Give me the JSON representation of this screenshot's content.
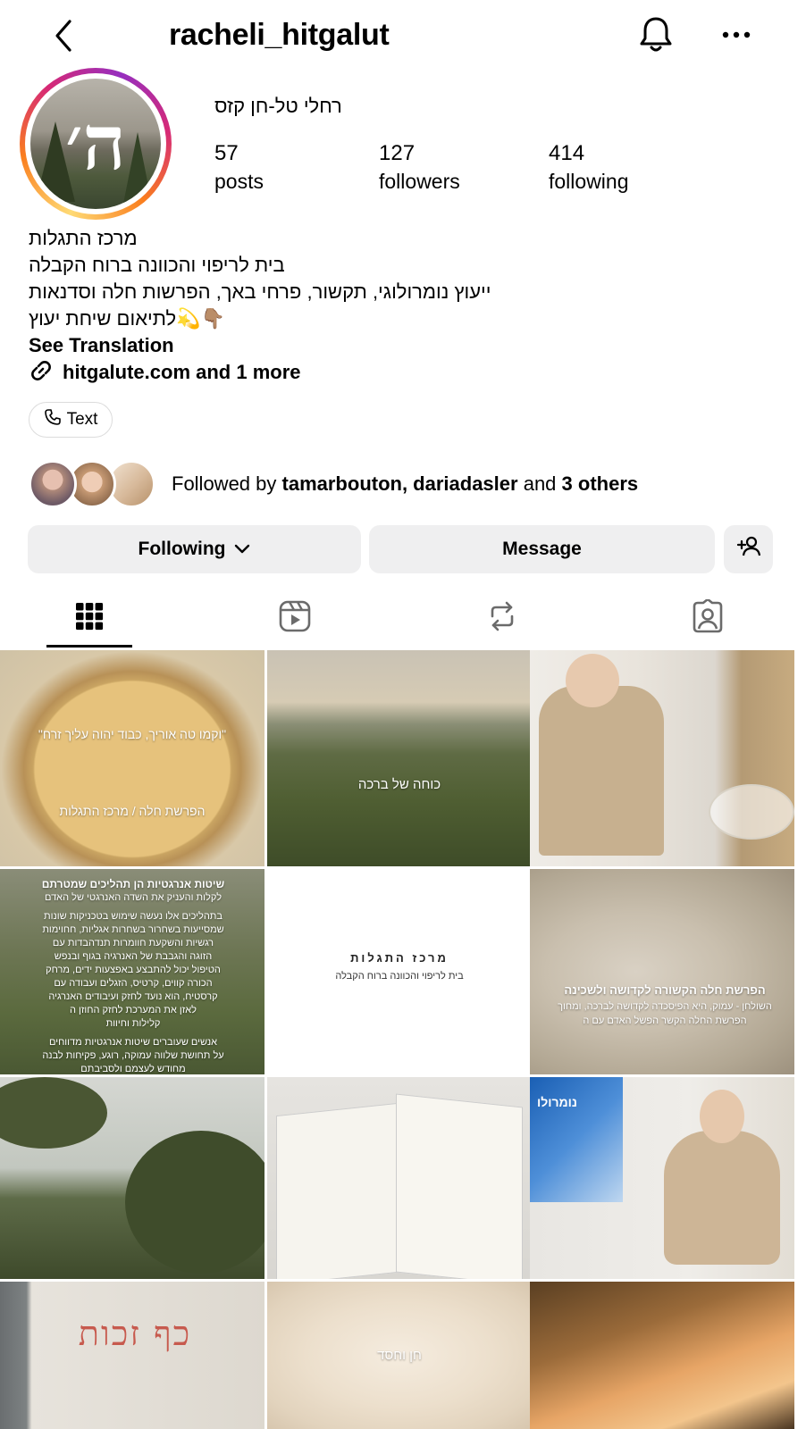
{
  "header": {
    "username": "racheli_hitgalut"
  },
  "profile": {
    "avatar_letter": "ה׳",
    "full_name": "רחלי טל-חן קזס",
    "stats": [
      {
        "value": "57",
        "label": "posts"
      },
      {
        "value": "127",
        "label": "followers"
      },
      {
        "value": "414",
        "label": "following"
      }
    ],
    "bio": {
      "line1": "מרכז התגלות",
      "line2": "בית לריפוי והכוונה ברוח הקבלה",
      "line3": "ייעוץ נומרולוגי, תקשור, פרחי באך, הפרשות חלה וסדנאות",
      "line4": "👇🏽💫לתיאום שיחת יעוץ"
    },
    "see_translation": "See Translation",
    "link_text": "hitgalute.com and 1 more",
    "contact_chip": "Text"
  },
  "followed_by": {
    "prefix": "Followed by ",
    "names": "tamarbouton, dariadasler",
    "middle": " and ",
    "others": "3 others"
  },
  "actions": {
    "following": "Following",
    "message": "Message"
  },
  "tabs": [
    {
      "icon": "grid-icon",
      "active": true
    },
    {
      "icon": "reels-icon",
      "active": false
    },
    {
      "icon": "reposts-icon",
      "active": false
    },
    {
      "icon": "tagged-icon",
      "active": false
    }
  ],
  "posts": {
    "p1_quote": "\"וקמו טה אוריך, כבוד יהוה עליך זרח\"",
    "p1_caption": "הפרשת חלה / מרכז התגלות",
    "p2_caption": "כוחה של ברכה",
    "p4_title": "שיטות אנרגטיות הן תהליכים שמטרתם",
    "p4_line1": "לקלות והעניק את השדה האנרגטי של האדם",
    "p4_line2": "בתהליכים אלו נעשה שימוש בטכניקות שונות",
    "p4_line3": "שמסייעות בשחרור בשחרות אגליות, חחוימות",
    "p4_line4": "רגשיות והשקעת חוומרות תנדהבדות עם",
    "p4_line5": "הזוגה והגבבת של האנרגיה בגוף ובנפש",
    "p4_line6": "הטיפול יכול להתבצע באפצעות ידים, מרחק",
    "p4_line7": "הכורה קווים, קרטיס, הזגלים ועבודה עם",
    "p4_line8": "קרסטיח, הוא נועד לחזק ועיבודים האנרגיה",
    "p4_line9": "לאזן את המערכת לחזק החוזן ה",
    "p4_line10": "קלילות וחיוות",
    "p4_line11": "אנשים שעוברים שיטות אנרגטיות מדווחים",
    "p4_line12": "על תחושת שלווה עמוקה, רוגע, פקיחות לבנה",
    "p4_line13": "מחודש לעצמם ולסביבתם",
    "p5_title": "מרכז התגלות",
    "p5_sub": "בית לריפוי והכוונה ברוח הקבלה",
    "p6_title": "הפרשת חלה הקשורה לקדושה ולשכינה",
    "p6_line1": "השולחן - עמוק, היא הפיסכדה לקדושה לברכה, ומחוך",
    "p6_line2": "הפרשת החלה הקשר הפשל האדם עם ה",
    "p9_screen": "נומרולו",
    "p10_text": "כף זכות",
    "p11_caption": "חן וחסד"
  },
  "colors": {
    "button_bg": "#efeff0",
    "ring_gradient": [
      "#feda75",
      "#fa7e1e",
      "#d62976",
      "#962fbf"
    ]
  }
}
